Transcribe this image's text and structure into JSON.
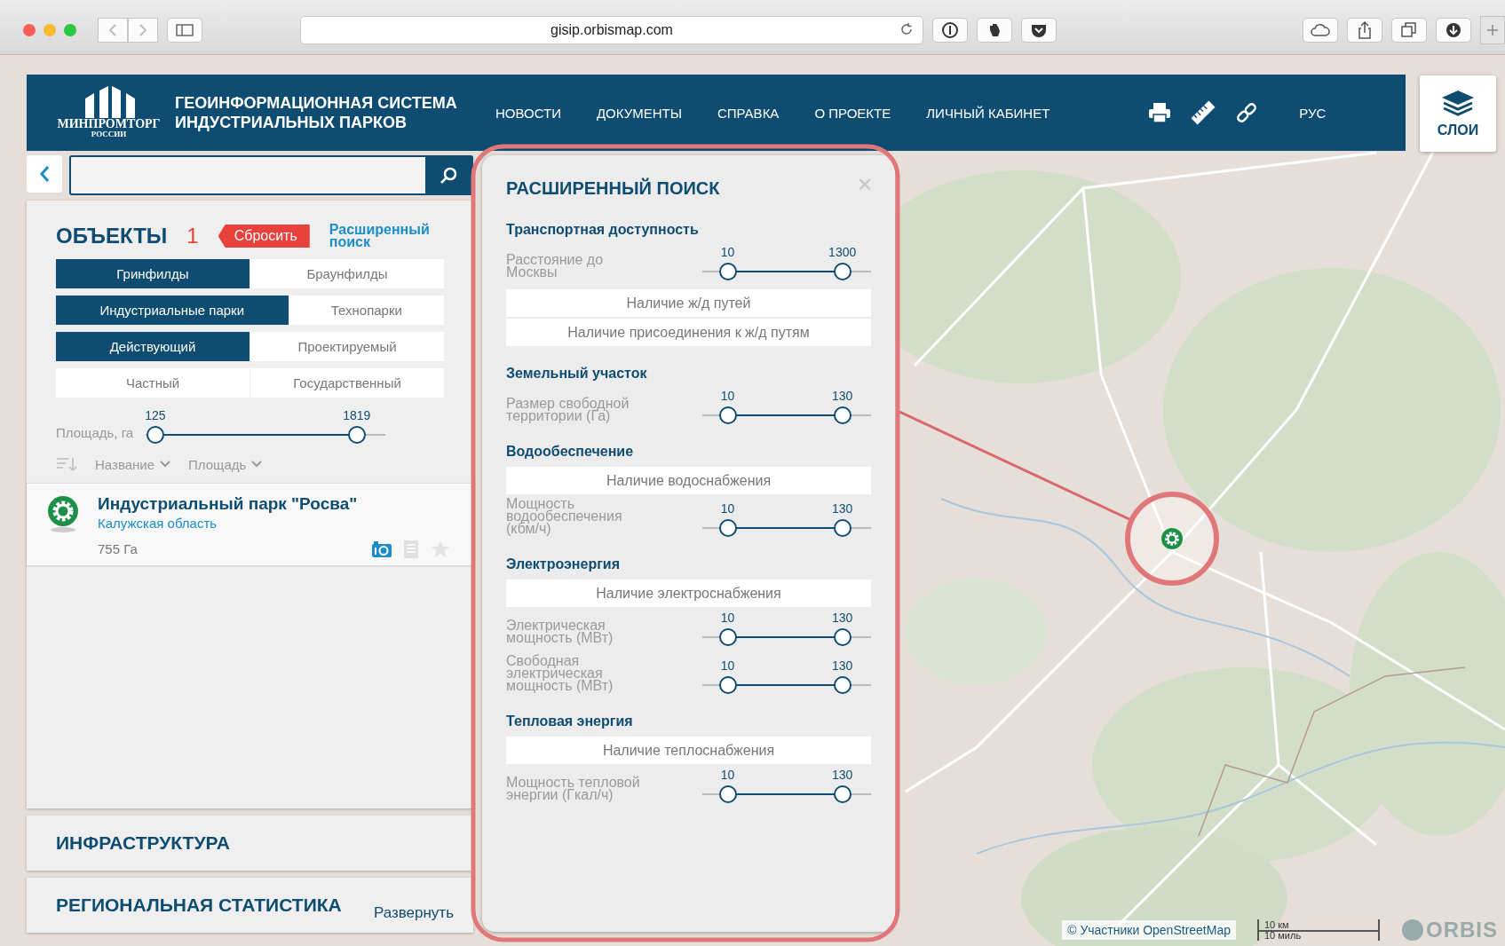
{
  "browser": {
    "url": "gisip.orbismap.com"
  },
  "header": {
    "logo_text": "МИНПРОМТОРГ",
    "logo_subtext": "РОССИИ",
    "title_lines": [
      "ГЕОИНФОРМАЦИОННАЯ СИСТЕМА",
      "ИНДУСТРИАЛЬНЫХ ПАРКОВ"
    ],
    "nav": [
      "НОВОСТИ",
      "ДОКУМЕНТЫ",
      "СПРАВКА",
      "О ПРОЕКТЕ",
      "ЛИЧНЫЙ КАБИНЕТ"
    ],
    "language": "РУС"
  },
  "layers_button": {
    "label": "СЛОИ"
  },
  "objects": {
    "title": "ОБЪЕКТЫ",
    "count": "1",
    "reset": "Сбросить",
    "advanced_link": "Расширенный поиск",
    "filters": [
      {
        "options": [
          {
            "label": "Гринфилды",
            "selected": true
          },
          {
            "label": "Браунфилды",
            "selected": false
          }
        ]
      },
      {
        "options": [
          {
            "label": "Индустриальные парки",
            "selected": true
          },
          {
            "label": "Технопарки",
            "selected": false
          }
        ]
      },
      {
        "options": [
          {
            "label": "Действующий",
            "selected": true
          },
          {
            "label": "Проектируемый",
            "selected": false
          }
        ]
      },
      {
        "options": [
          {
            "label": "Частный",
            "selected": false
          },
          {
            "label": "Государственный",
            "selected": false
          }
        ]
      }
    ],
    "area_slider": {
      "label": "Площадь, га",
      "readings": [
        "125",
        "1819"
      ],
      "thumbs": [
        {
          "level": 0.04
        },
        {
          "level": 0.88
        }
      ]
    },
    "sort": [
      {
        "label": "Название"
      },
      {
        "label": "Площадь"
      }
    ],
    "results": [
      {
        "title": "Индустриальный парк \"Росва\"",
        "region": "Калужская область",
        "area": "755 Га"
      }
    ]
  },
  "panels": [
    {
      "title": "ИНФРАСТРУКТУРА"
    },
    {
      "title": "РЕГИОНАЛЬНАЯ СТАТИСТИКА",
      "action": "Развернуть"
    }
  ],
  "advanced_search": {
    "title": "РАСШИРЕННЫЙ ПОИСК",
    "close": "×",
    "sections": [
      {
        "title": "Транспортная доступность",
        "items": [
          {
            "kind": "slider",
            "label": "Расстояние до Москвы",
            "readings": [
              "10",
              "1300"
            ],
            "thumbs": [
              {
                "level": 0.15
              },
              {
                "level": 0.83
              }
            ]
          },
          {
            "kind": "toggle",
            "label": "Наличие ж/д путей",
            "selected": false
          },
          {
            "kind": "toggle",
            "label": "Наличие присоединения к  ж/д путям",
            "selected": false
          }
        ]
      },
      {
        "title": "Земельный участок",
        "items": [
          {
            "kind": "slider",
            "label": "Размер свободной территории (Га)",
            "readings": [
              "10",
              "130"
            ],
            "thumbs": [
              {
                "level": 0.15
              },
              {
                "level": 0.83
              }
            ]
          }
        ]
      },
      {
        "title": "Водообеспечение",
        "items": [
          {
            "kind": "toggle",
            "label": "Наличие водоснабжения",
            "selected": false
          },
          {
            "kind": "slider",
            "label": "Мощность водообеспечения (кбм/ч)",
            "readings": [
              "10",
              "130"
            ],
            "thumbs": [
              {
                "level": 0.15
              },
              {
                "level": 0.83
              }
            ]
          }
        ]
      },
      {
        "title": "Электроэнергия",
        "items": [
          {
            "kind": "toggle",
            "label": "Наличие электроснабжения",
            "selected": false
          },
          {
            "kind": "slider",
            "label": "Электрическая мощность (МВт)",
            "readings": [
              "10",
              "130"
            ],
            "thumbs": [
              {
                "level": 0.15
              },
              {
                "level": 0.83
              }
            ]
          },
          {
            "kind": "slider",
            "label": "Свободная электрическая мощность (МВт)",
            "readings": [
              "10",
              "130"
            ],
            "thumbs": [
              {
                "level": 0.15
              },
              {
                "level": 0.83
              }
            ]
          }
        ]
      },
      {
        "title": "Тепловая энергия",
        "items": [
          {
            "kind": "toggle",
            "label": "Наличие теплоснабжения",
            "selected": false
          },
          {
            "kind": "slider",
            "label": "Мощность тепловой энергии (Гкал/ч)",
            "readings": [
              "10",
              "130"
            ],
            "thumbs": [
              {
                "level": 0.15
              },
              {
                "level": 0.83
              }
            ]
          }
        ]
      }
    ]
  },
  "map": {
    "attribution": "© Участники OpenStreetMap",
    "scale": [
      "10 км",
      "10 миль"
    ],
    "logo": "ORBIS"
  }
}
